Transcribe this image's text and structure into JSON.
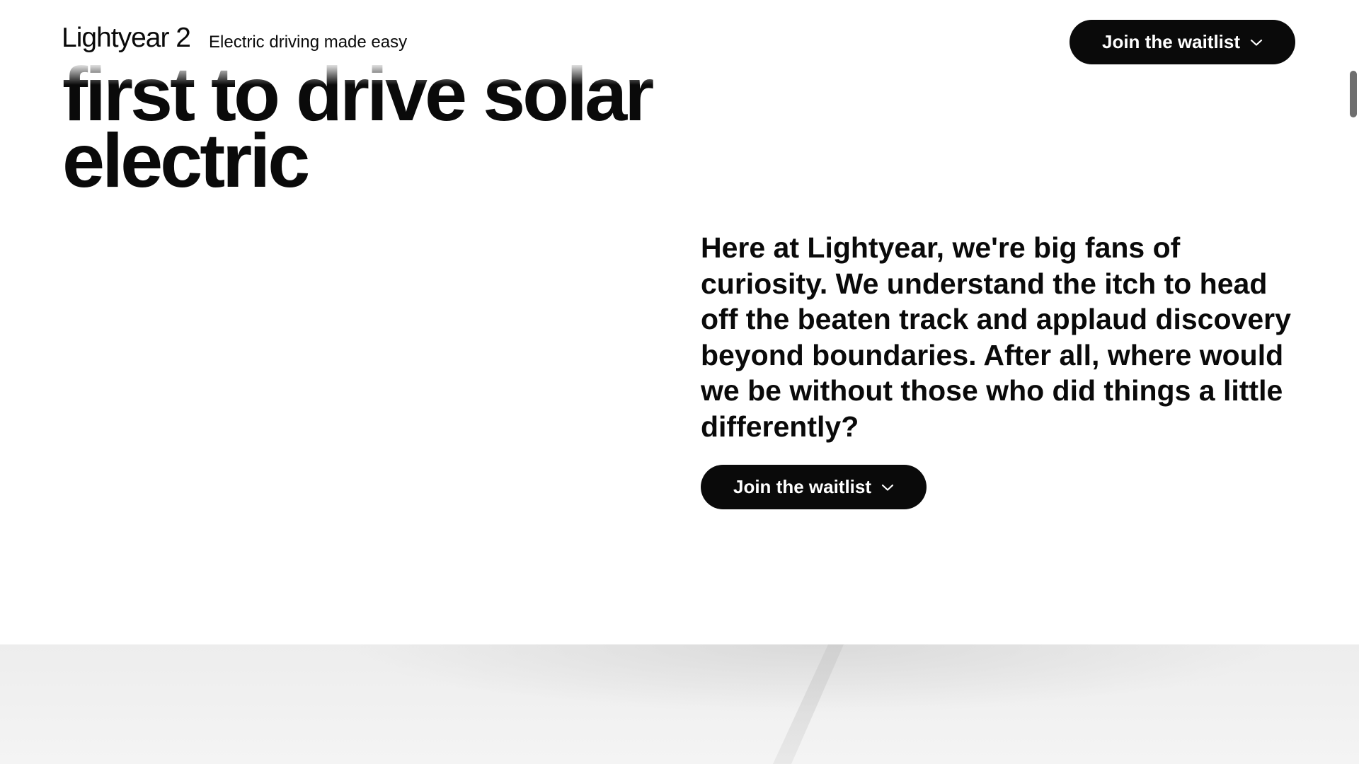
{
  "nav": {
    "brand": "Lightyear 2",
    "tagline": "Electric driving made easy",
    "cta_label": "Join the waitlist",
    "cta_icon": "chevron-down-icon"
  },
  "hero": {
    "title_line_1": "first to drive solar",
    "title_line_2": "electric"
  },
  "intro": {
    "text": "Here at Lightyear, we're big fans of curiosity. We understand the itch to head off the beaten track and applaud discovery beyond boundaries. After all, where would we be without those who did things a little differently?",
    "cta_label": "Join the waitlist",
    "cta_icon": "chevron-down-icon"
  },
  "colors": {
    "text": "#0a0a0a",
    "button_bg": "#0a0a0a",
    "button_text": "#ffffff",
    "background": "#ffffff",
    "image_band": "#efefef"
  }
}
